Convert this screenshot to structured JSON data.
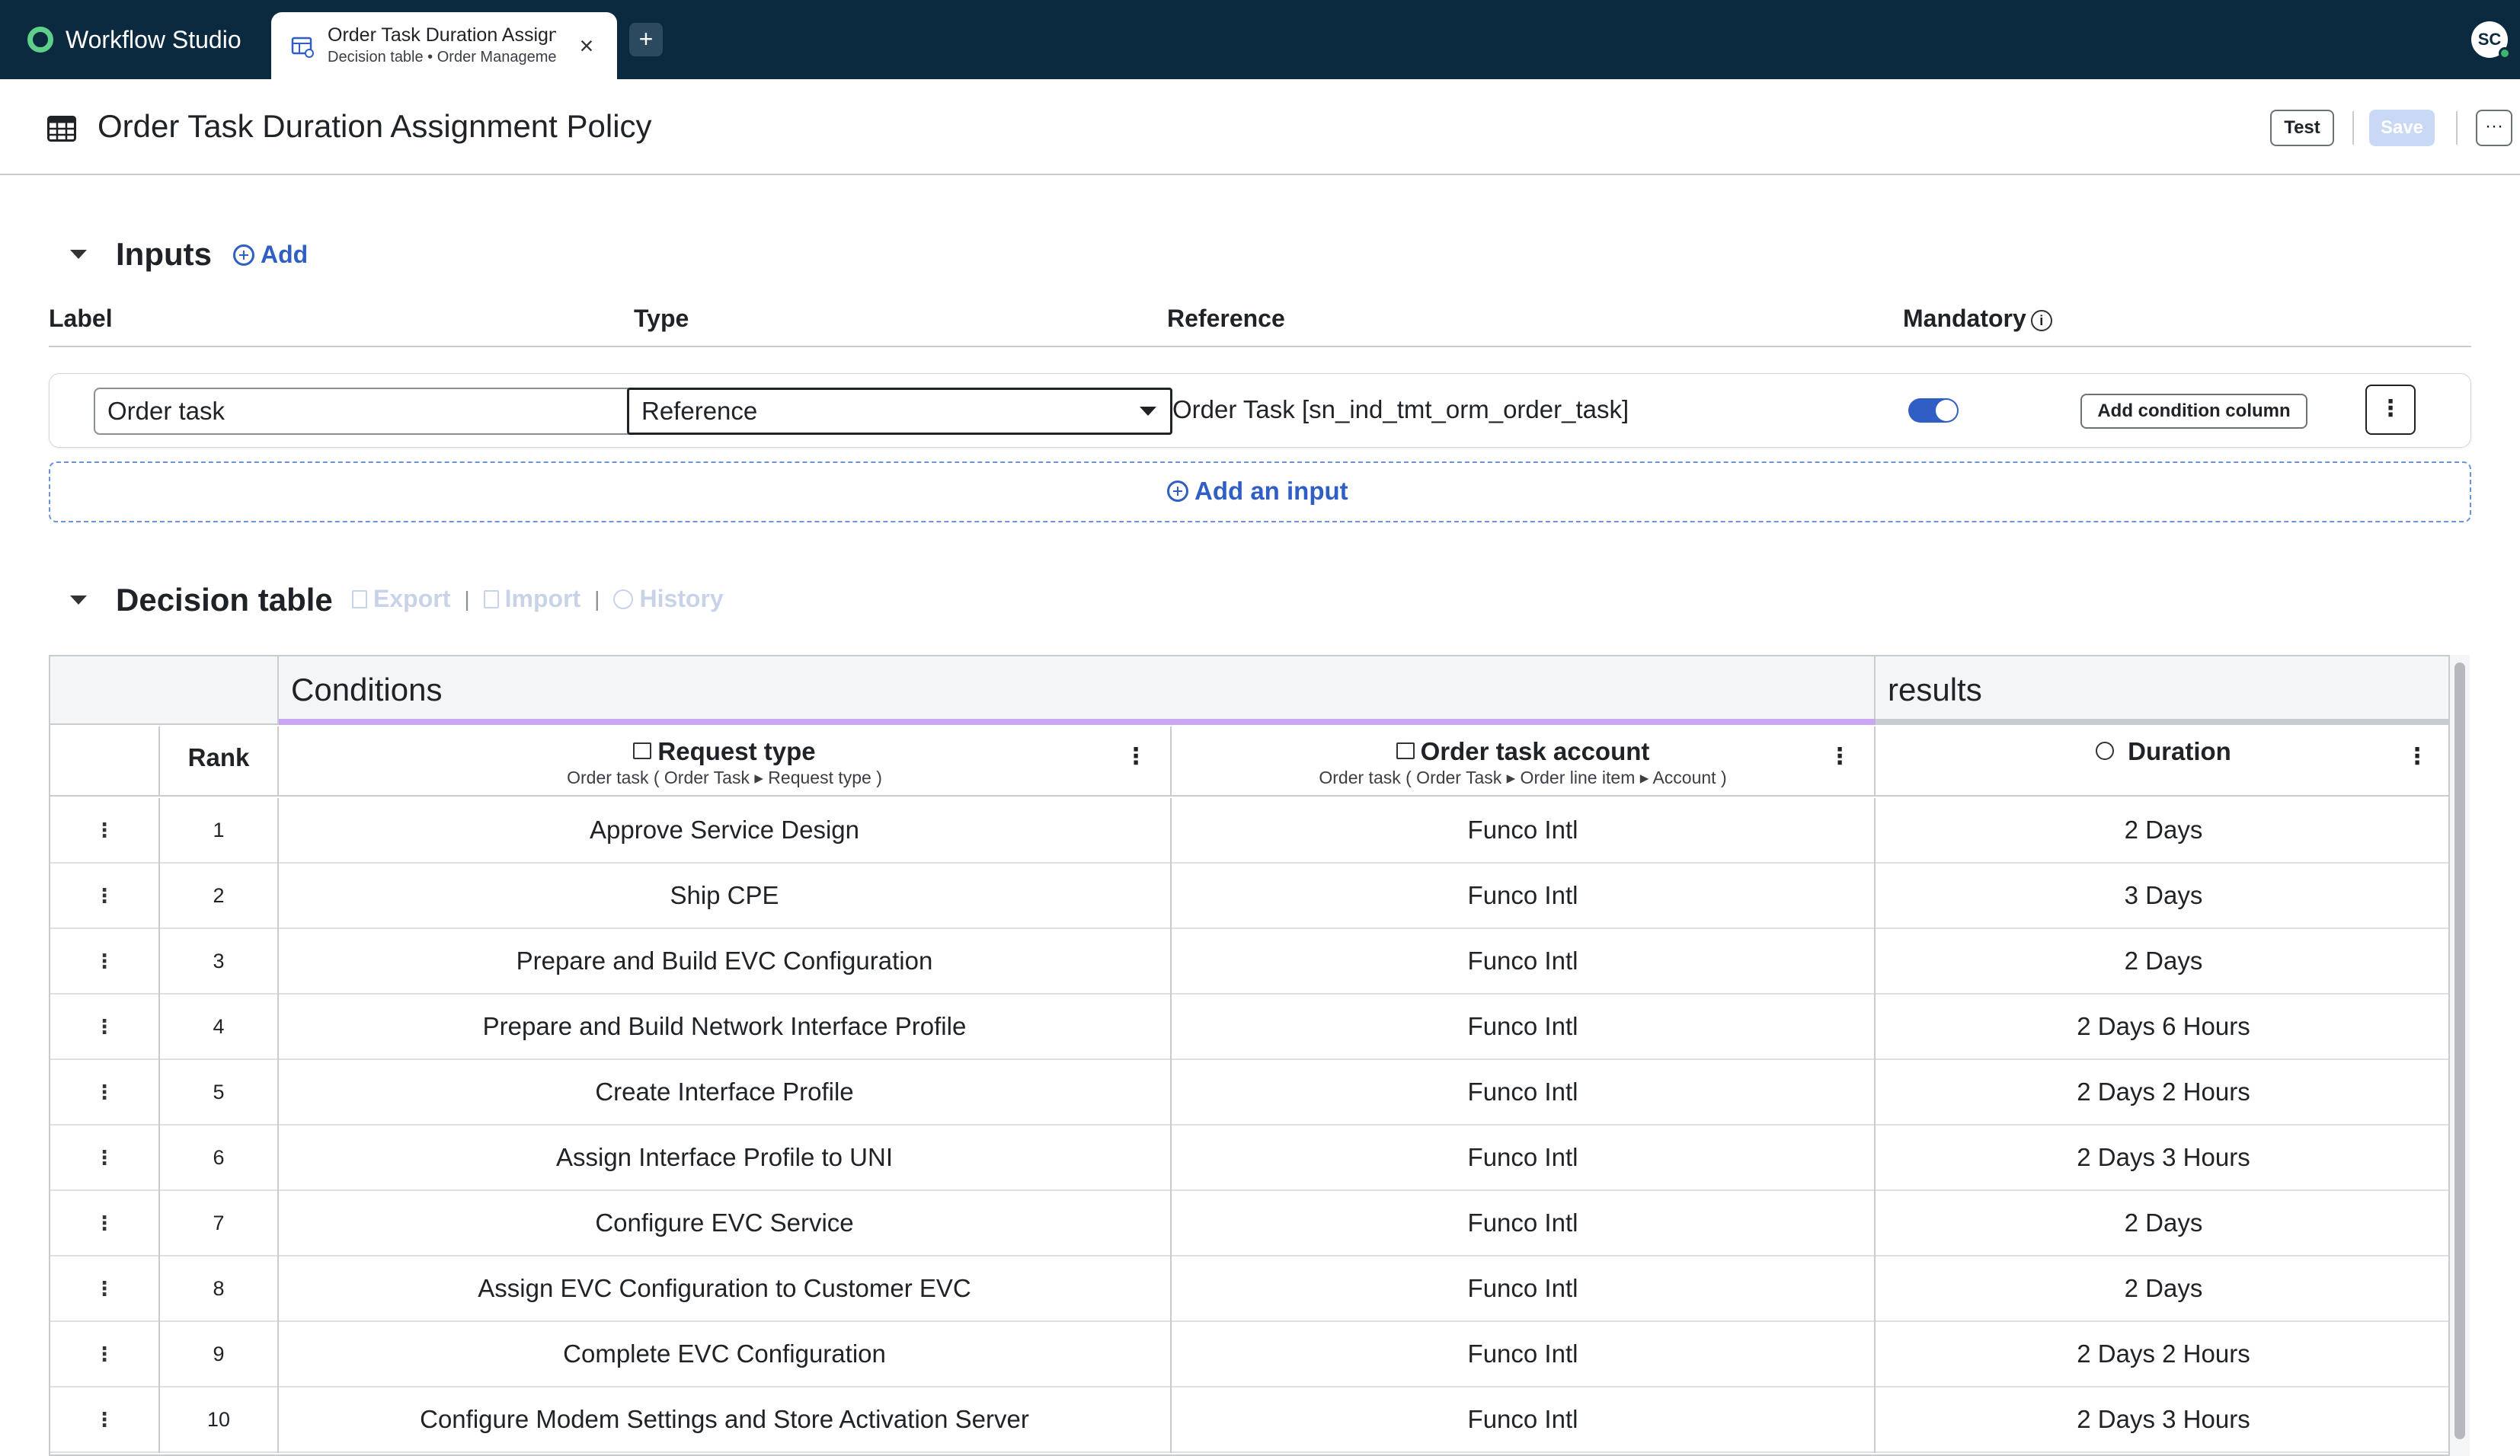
{
  "app": {
    "name": "Workflow Studio"
  },
  "tab": {
    "title": "Order Task Duration Assignment Policy",
    "subtitle": "Decision table • Order Management",
    "close": "×",
    "new_tab": "+"
  },
  "user": {
    "initials": "SC"
  },
  "page": {
    "title": "Order Task Duration Assignment Policy"
  },
  "toolbar": {
    "test_label": "Test",
    "save_label": "Save",
    "more_label": "···"
  },
  "inputs": {
    "title": "Inputs",
    "add_label": "Add",
    "columns": {
      "label": "Label",
      "type": "Type",
      "reference": "Reference",
      "mandatory": "Mandatory"
    },
    "row": {
      "label_value": "Order task",
      "type_value": "Reference",
      "reference_value": "Order Task [sn_ind_tmt_orm_order_task]",
      "mandatory": true,
      "add_condition_label": "Add condition column"
    },
    "add_input_label": "Add an input"
  },
  "decision_table": {
    "title": "Decision table",
    "export_label": "Export",
    "import_label": "Import",
    "history_label": "History",
    "separator": "|",
    "groups": {
      "conditions": "Conditions",
      "results": "results"
    },
    "headers": {
      "rank": "Rank",
      "request_type": {
        "title": "Request type",
        "path": "Order task ( Order Task ▸ Request type )"
      },
      "order_task_account": {
        "title": "Order task account",
        "path": "Order task ( Order Task ▸ Order line item ▸ Account )"
      },
      "duration": {
        "title": "Duration"
      }
    },
    "rows": [
      {
        "rank": "1",
        "request_type": "Approve Service Design",
        "account": "Funco Intl",
        "duration": "2 Days"
      },
      {
        "rank": "2",
        "request_type": "Ship CPE",
        "account": "Funco Intl",
        "duration": "3 Days"
      },
      {
        "rank": "3",
        "request_type": "Prepare and Build EVC Configuration",
        "account": "Funco Intl",
        "duration": "2 Days"
      },
      {
        "rank": "4",
        "request_type": "Prepare and Build Network Interface Profile",
        "account": "Funco Intl",
        "duration": "2 Days 6 Hours"
      },
      {
        "rank": "5",
        "request_type": "Create Interface Profile",
        "account": "Funco Intl",
        "duration": "2 Days 2 Hours"
      },
      {
        "rank": "6",
        "request_type": "Assign Interface Profile to UNI",
        "account": "Funco Intl",
        "duration": "2 Days 3 Hours"
      },
      {
        "rank": "7",
        "request_type": "Configure EVC Service",
        "account": "Funco Intl",
        "duration": "2 Days"
      },
      {
        "rank": "8",
        "request_type": "Assign EVC Configuration to Customer EVC",
        "account": "Funco Intl",
        "duration": "2 Days"
      },
      {
        "rank": "9",
        "request_type": "Complete EVC Configuration",
        "account": "Funco Intl",
        "duration": "2 Days 2 Hours"
      },
      {
        "rank": "10",
        "request_type": "Configure Modem Settings and Store Activation Server",
        "account": "Funco Intl",
        "duration": "2 Days 3 Hours"
      }
    ]
  },
  "colors": {
    "topbar": "#0b2a3f",
    "accent": "#2f5fc4",
    "conditions_bar": "#c9a6f0",
    "results_bar": "#c8ccd1"
  }
}
